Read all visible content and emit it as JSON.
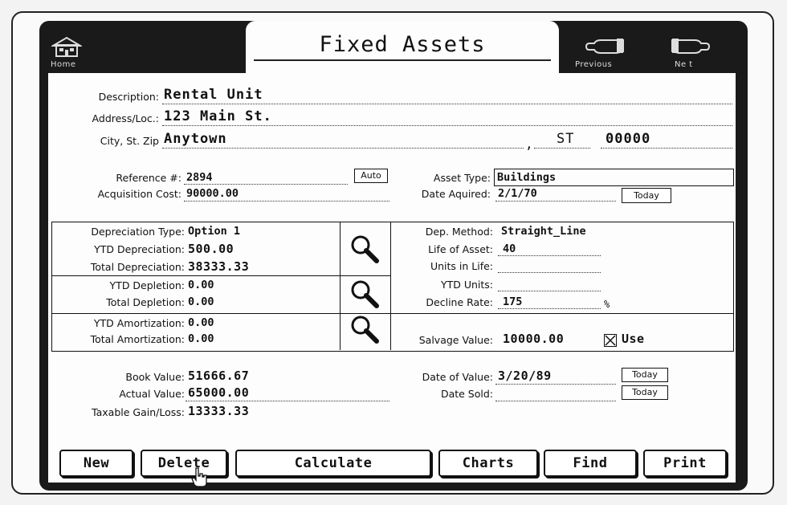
{
  "window": {
    "title": "Fixed Assets"
  },
  "nav": {
    "home": "Home",
    "previous": "Previous",
    "next": "Ne t"
  },
  "address": {
    "description_label": "Description:",
    "description": "Rental Unit",
    "address_label": "Address/Loc.:",
    "address": "123 Main St.",
    "city_label": "City, St. Zip",
    "city": "Anytown",
    "comma": ",",
    "state": "ST",
    "zip": "00000"
  },
  "ref": {
    "reference_label": "Reference #:",
    "reference": "2894",
    "auto_label": "Auto",
    "acq_cost_label": "Acquisition Cost:",
    "acq_cost": "90000.00",
    "asset_type_label": "Asset Type:",
    "asset_type": "Buildings",
    "date_acq_label": "Date Aquired:",
    "date_acq": "2/1/70",
    "today_label": "Today"
  },
  "depreciation": {
    "type_label": "Depreciation Type:",
    "type": "Option 1",
    "ytd_dep_label": "YTD Depreciation:",
    "ytd_dep": "500.00",
    "total_dep_label": "Total Depreciation:",
    "total_dep": "38333.33",
    "ytd_depl_label": "YTD Depletion:",
    "ytd_depl": "0.00",
    "total_depl_label": "Total Depletion:",
    "total_depl": "0.00",
    "ytd_amort_label": "YTD Amortization:",
    "ytd_amort": "0.00",
    "total_amort_label": "Total Amortization:",
    "total_amort": "0.00",
    "method_label": "Dep. Method:",
    "method": "Straight_Line",
    "life_label": "Life of Asset:",
    "life": "40",
    "units_life_label": "Units in Life:",
    "units_life": "",
    "ytd_units_label": "YTD Units:",
    "ytd_units": "",
    "decline_label": "Decline Rate:",
    "decline": "175",
    "percent": "%",
    "salvage_label": "Salvage Value:",
    "salvage": "10000.00",
    "use_label": "Use"
  },
  "values": {
    "book_label": "Book Value:",
    "book": "51666.67",
    "actual_label": "Actual Value:",
    "actual": "65000.00",
    "gain_label": "Taxable Gain/Loss:",
    "gain": "13333.33",
    "date_value_label": "Date of Value:",
    "date_value": "3/20/89",
    "date_sold_label": "Date Sold:",
    "date_sold": "",
    "today_label": "Today"
  },
  "buttons": {
    "new": "New",
    "delete": "Delete",
    "calculate": "Calculate",
    "charts": "Charts",
    "find": "Find",
    "print": "Print"
  }
}
